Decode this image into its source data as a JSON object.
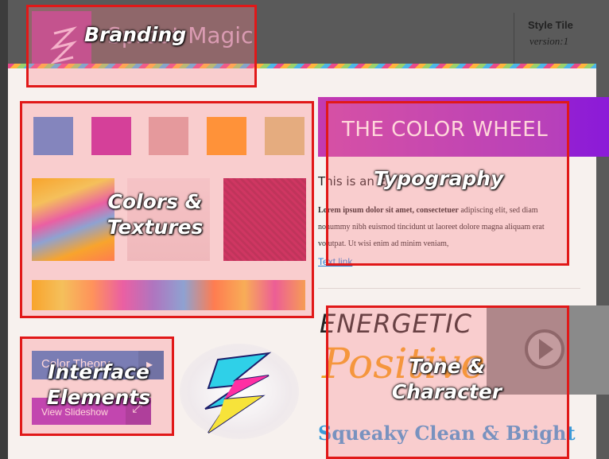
{
  "header": {
    "brand_name": "Sprout Magic",
    "style_tile_title": "Style Tile",
    "style_tile_version": "version:1"
  },
  "colors": {
    "swatches": [
      "#4b86d4",
      "#c2219f",
      "#d9a4a4",
      "#ff9a12",
      "#d9c07a"
    ],
    "accent_banner": "#b52dc0",
    "link": "#2a7fd4",
    "positive_orange": "#f0a018",
    "squeaky_blue": "#3a9ad8",
    "overlay_border": "#e11818"
  },
  "typography": {
    "banner_title": "THE COLOR WHEEL",
    "heading_prefix": "This is an E",
    "paragraph_bold": "Lorem ipsum dolor sit amet, consectetuer",
    "paragraph_rest": " adipiscing elit, sed diam nonummy nibh euismod tincidunt ut laoreet dolore magna aliquam erat volutpat. Ut wisi enim ad minim veniam,",
    "link_text": "Text link"
  },
  "tone": {
    "energetic": "ENERGETIC",
    "positive": "Positive",
    "squeaky": "Squeaky Clean & Bright"
  },
  "interface": {
    "button_color_theory": "Color Theory",
    "button_view_slideshow": "View Slideshow"
  },
  "overlays": {
    "branding": "Branding",
    "colors_textures_line1": "Colors &",
    "colors_textures_line2": "Textures",
    "typography": "Typography",
    "interface_line1": "Interface",
    "interface_line2": "Elements",
    "tone_line1": "Tone &",
    "tone_line2": "Character"
  },
  "icons": {
    "logo": "lightning-s-logo-icon",
    "play": "play-icon",
    "arrow": "chevron-right-icon",
    "expand": "expand-icon"
  }
}
